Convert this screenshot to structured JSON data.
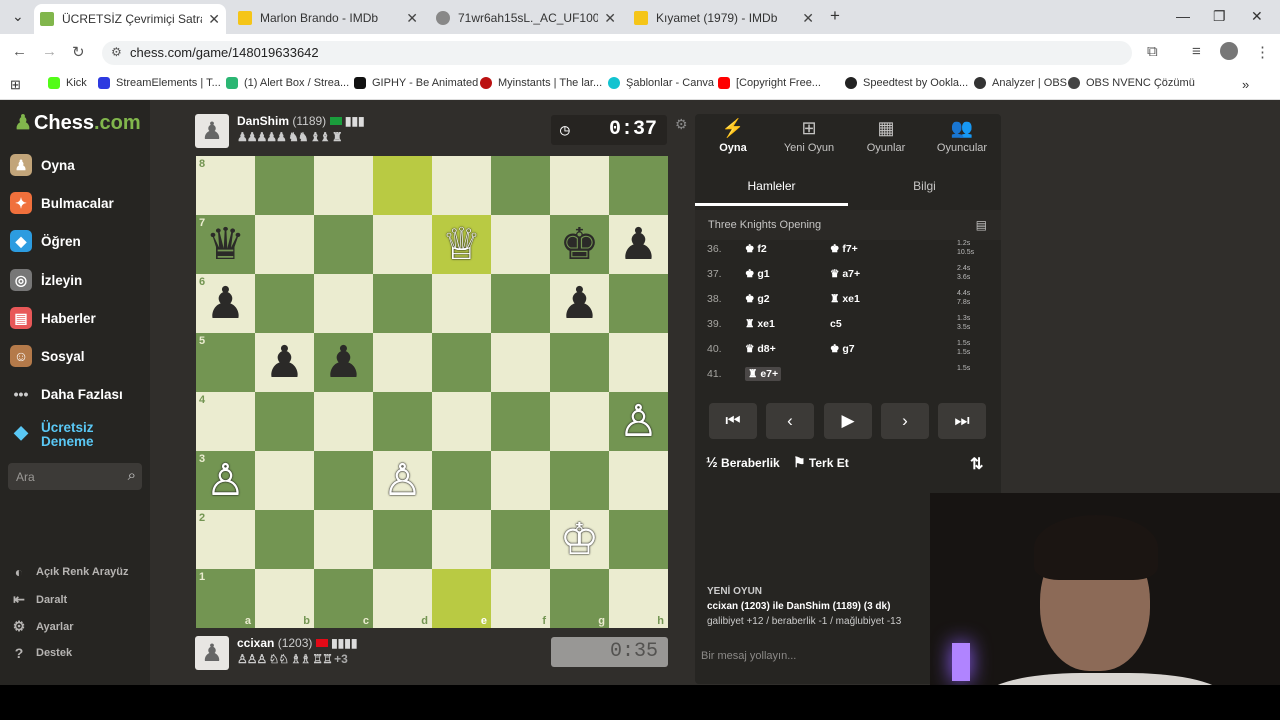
{
  "tabs": [
    {
      "title": "ÜCRETSİZ Çevrimiçi Satranç Oyn",
      "color": "#81b64c"
    },
    {
      "title": "Marlon Brando - IMDb",
      "color": "#f5c518"
    },
    {
      "title": "71wr6ah15sL._AC_UF1000,1000",
      "color": "#888888"
    },
    {
      "title": "Kıyamet (1979) - IMDb",
      "color": "#f5c518"
    }
  ],
  "url": "chess.com/game/148019633642",
  "bookmarks": [
    "Kick",
    "StreamElements | T...",
    "(1) Alert Box / Strea...",
    "GIPHY - Be Animated",
    "Myinstants | The lar...",
    "Şablonlar - Canva",
    "[Copyright Free...",
    "Speedtest by Ookla...",
    "Analyzer | OBS",
    "OBS NVENC Çözümü"
  ],
  "sidebar": {
    "logo_a": "Chess",
    "logo_b": ".com",
    "items": [
      "Oyna",
      "Bulmacalar",
      "Öğren",
      "İzleyin",
      "Haberler",
      "Sosyal",
      "Daha Fazlası",
      "Ücretsiz Deneme"
    ],
    "search_placeholder": "Ara",
    "footer": [
      "Açık Renk Arayüz",
      "Daralt",
      "Ayarlar",
      "Destek"
    ]
  },
  "top_player": {
    "name": "DanShim",
    "rating": "(1189)",
    "captured": "♟♟♟♟♟ ♞♞ ♝♝ ♜",
    "clock": "0:37"
  },
  "bottom_player": {
    "name": "ccixan",
    "rating": "(1203)",
    "captured": "♙♙♙ ♘♘ ♗♗ ♖♖",
    "advantage": "+3",
    "clock": "0:35"
  },
  "board": {
    "files": [
      "a",
      "b",
      "c",
      "d",
      "e",
      "f",
      "g",
      "h"
    ],
    "ranks": [
      "8",
      "7",
      "6",
      "5",
      "4",
      "3",
      "2",
      "1"
    ],
    "highlights": [
      "d8",
      "e7",
      "e1"
    ],
    "pieces": {
      "a7": "♛b",
      "e7": "♕w",
      "g7": "♚b",
      "h7": "♟b",
      "a6": "♟b",
      "g6": "♟b",
      "b5": "♟b",
      "c5": "♟b",
      "h4": "♙w",
      "a3": "♙w",
      "d3": "♙w",
      "g2": "♔w"
    }
  },
  "panel": {
    "tabs": [
      {
        "label": "Oyna",
        "icon": "⚡"
      },
      {
        "label": "Yeni Oyun",
        "icon": "⊞"
      },
      {
        "label": "Oyunlar",
        "icon": "▦"
      },
      {
        "label": "Oyuncular",
        "icon": "👥"
      }
    ],
    "subtabs": [
      "Hamleler",
      "Bilgi"
    ],
    "opening": "Three Knights Opening",
    "moves": [
      {
        "n": "36.",
        "w": "♚ f2",
        "b": "♚ f7+",
        "t1": "1.2s",
        "t2": "10.5s"
      },
      {
        "n": "37.",
        "w": "♚ g1",
        "b": "♛ a7+",
        "t1": "2.4s",
        "t2": "3.6s"
      },
      {
        "n": "38.",
        "w": "♚ g2",
        "b": "♜ xe1",
        "t1": "4.4s",
        "t2": "7.8s"
      },
      {
        "n": "39.",
        "w": "♜ xe1",
        "b": "c5",
        "t1": "1.3s",
        "t2": "3.5s"
      },
      {
        "n": "40.",
        "w": "♛ d8+",
        "b": "♚ g7",
        "t1": "1.5s",
        "t2": "1.5s"
      },
      {
        "n": "41.",
        "w": "♜ e7+",
        "b": "",
        "t1": "1.5s",
        "t2": ""
      }
    ],
    "controls": [
      "⏮",
      "‹",
      "▶",
      "›",
      "⏭"
    ],
    "draw": "Beraberlik",
    "draw_icon": "½",
    "resign": "Terk Et",
    "resign_icon": "⚑",
    "flip_icon": "⇅",
    "new_game_title": "YENİ OYUN",
    "new_game_line": "ccixan (1203) ile DanShim (1189) (3 dk)",
    "new_game_stats": "galibiyet +12 / beraberlik -1 / mağlubiyet -13",
    "chat_placeholder": "Bir mesaj yollayın..."
  }
}
